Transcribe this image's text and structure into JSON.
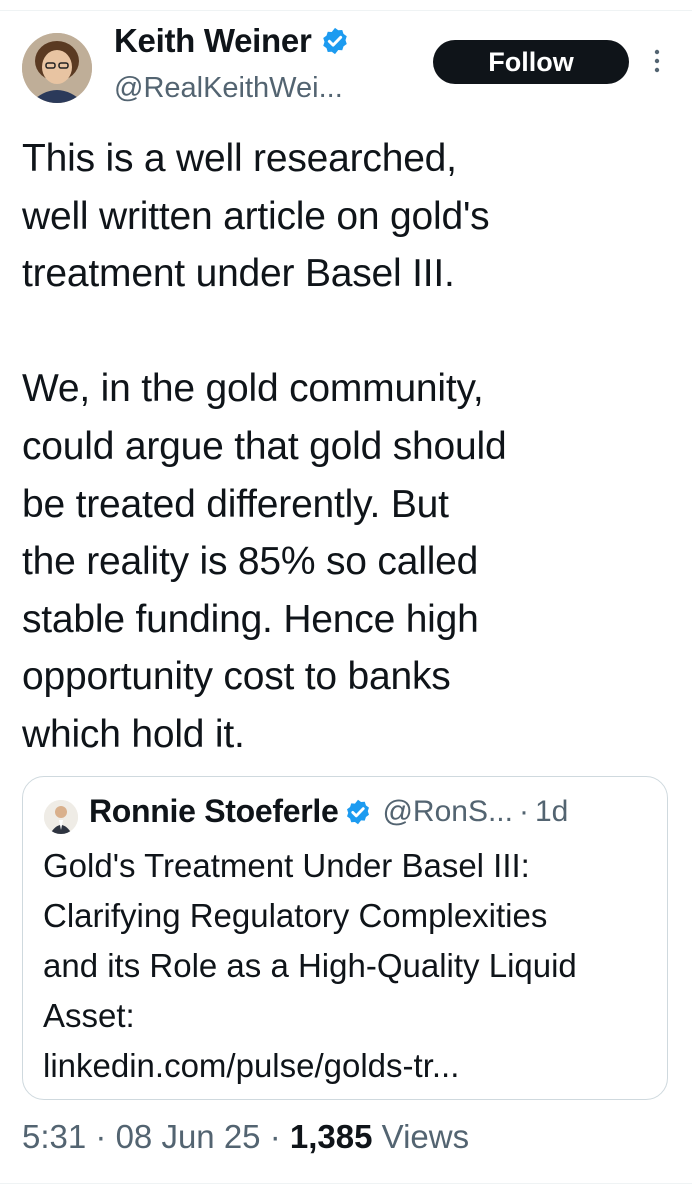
{
  "author": {
    "display_name": "Keith Weiner",
    "handle": "@RealKeithWei...",
    "verified_icon": "verified-badge-icon",
    "avatar_icon": "avatar"
  },
  "actions": {
    "follow_label": "Follow",
    "more_icon": "more-vertical-icon"
  },
  "tweet": {
    "text": "This is a well researched,\nwell written article on gold's\ntreatment under Basel III.\n\nWe, in the gold community,\ncould argue that gold should\nbe treated differently. But\nthe reality is 85% so called\nstable funding. Hence high\nopportunity cost to banks\nwhich hold it."
  },
  "quote": {
    "display_name": "Ronnie Stoeferle",
    "handle": "@RonS...",
    "separator": "·",
    "time": "1d",
    "lines": [
      "Gold's Treatment Under Basel III:",
      "Clarifying Regulatory Complexities",
      "and its Role as a High-Quality Liquid",
      "Asset:",
      "linkedin.com/pulse/golds-tr..."
    ]
  },
  "meta": {
    "time": "5:31",
    "sep1": "·",
    "date": "08 Jun 25",
    "sep2": "·",
    "views_count": "1,385",
    "views_label": "Views"
  },
  "colors": {
    "text": "#0f1419",
    "secondary": "#536471",
    "verified": "#1d9bf0",
    "border": "#cfd9de"
  }
}
